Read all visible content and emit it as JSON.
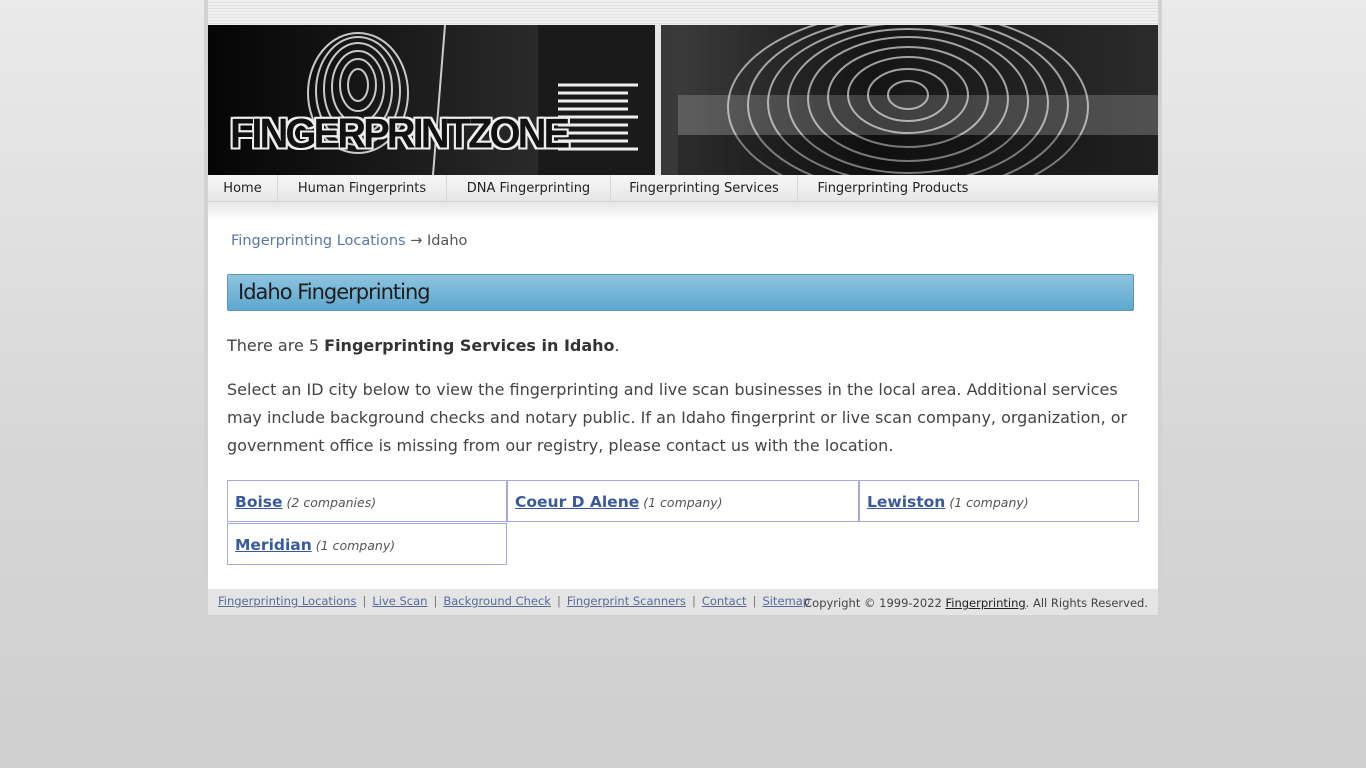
{
  "site": {
    "logo_text": "FINGERPRINTZONE"
  },
  "nav": {
    "items": [
      {
        "label": "Home"
      },
      {
        "label": "Human Fingerprints"
      },
      {
        "label": "DNA Fingerprinting"
      },
      {
        "label": "Fingerprinting Services"
      },
      {
        "label": "Fingerprinting Products"
      }
    ]
  },
  "breadcrumb": {
    "parent": "Fingerprinting Locations",
    "arrow": "→",
    "current": "Idaho"
  },
  "main": {
    "title": "Idaho Fingerprinting",
    "intro_prefix": "There are 5 ",
    "intro_bold": "Fingerprinting Services in Idaho",
    "intro_suffix": ".",
    "description": "Select an ID city below to view the fingerprinting and live scan businesses in the local area. Additional services may include background checks and notary public. If an Idaho fingerprint or live scan company, organization, or government office is missing from our registry, please contact us with the location.",
    "cities": [
      {
        "name": "Boise",
        "count": "(2 companies)"
      },
      {
        "name": "Coeur D Alene",
        "count": "(1 company)"
      },
      {
        "name": "Lewiston",
        "count": "(1 company)"
      },
      {
        "name": "Meridian",
        "count": "(1 company)"
      }
    ]
  },
  "footer": {
    "links": [
      {
        "label": "Fingerprinting Locations"
      },
      {
        "label": "Live Scan"
      },
      {
        "label": "Background Check"
      },
      {
        "label": "Fingerprint Scanners"
      },
      {
        "label": "Contact"
      },
      {
        "label": "Sitemap"
      }
    ],
    "separator": "|",
    "copyright_prefix": "Copyright © 1999-2022 ",
    "copyright_link": "Fingerprinting",
    "copyright_suffix": ". All Rights Reserved."
  }
}
